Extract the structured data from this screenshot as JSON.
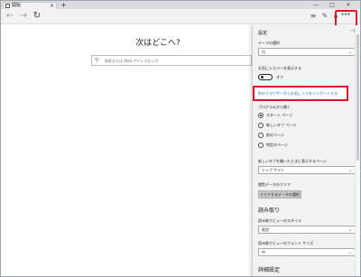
{
  "titlebar": {
    "tab_label": "開始",
    "tab_close": "×",
    "new_tab": "+",
    "win_min": "—",
    "win_max": "□",
    "win_close": "×"
  },
  "navbar": {
    "back_icon": "←",
    "forward_icon": "→",
    "refresh_icon": "↻",
    "hub_icon": "≡",
    "note_icon": "✎",
    "share_icon": "⌂",
    "more_icon": "···"
  },
  "main": {
    "headline": "次はどこへ?",
    "search_icon": "⚲",
    "search_placeholder": "検索または Web アドレスを入力"
  },
  "settings": {
    "title": "設定",
    "pin_icon": "⊣",
    "theme_label": "テーマの選択",
    "theme_value": "白",
    "favorites_bar_label": "お気に入りバーを表示する",
    "favorites_bar_toggle": "オフ",
    "import_link": "別のブラウザーからお気に入りをインポートする",
    "open_with_label": "プログラムから開く",
    "open_with_options": [
      {
        "label": "スタート ページ",
        "selected": true
      },
      {
        "label": "新しいタブ ページ",
        "selected": false
      },
      {
        "label": "前のページ",
        "selected": false
      },
      {
        "label": "特定のページ",
        "selected": false
      }
    ],
    "newtab_label": "新しいタブを開いたときに表示するページ",
    "newtab_value": "トップ サイト",
    "clear_data_label": "閲覧データのクリア",
    "clear_data_button": "クリアするデータの選択",
    "reading_section": "読み取り",
    "reading_style_label": "読み取りビューのスタイル",
    "reading_style_value": "既定",
    "reading_font_label": "読み取りビューのフォント サイズ",
    "reading_font_value": "中",
    "advanced_section": "詳細設定",
    "dropdown_chevron": "⌄"
  },
  "colors": {
    "highlight": "#e0112b",
    "link": "#1565c0",
    "panel_bg": "#f2f2f2"
  }
}
